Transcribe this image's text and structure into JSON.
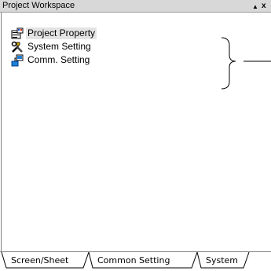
{
  "window": {
    "title": "Project Workspace"
  },
  "titlebar": {
    "up_glyph": "▲",
    "close_glyph": "x"
  },
  "tree": {
    "items": [
      {
        "label": "Project Property",
        "icon": "project-property-icon",
        "selected": true
      },
      {
        "label": "System Setting",
        "icon": "system-setting-icon",
        "selected": false
      },
      {
        "label": "Comm. Setting",
        "icon": "comm-setting-icon",
        "selected": false
      }
    ]
  },
  "tabs": [
    {
      "label": "Screen/Sheet",
      "active": false
    },
    {
      "label": "Common Setting",
      "active": false
    },
    {
      "label": "System",
      "active": true
    }
  ],
  "colors": {
    "titlebar_bg": "#d8d8d8",
    "selected_bg": "#e4e4e4",
    "border": "#808080"
  }
}
